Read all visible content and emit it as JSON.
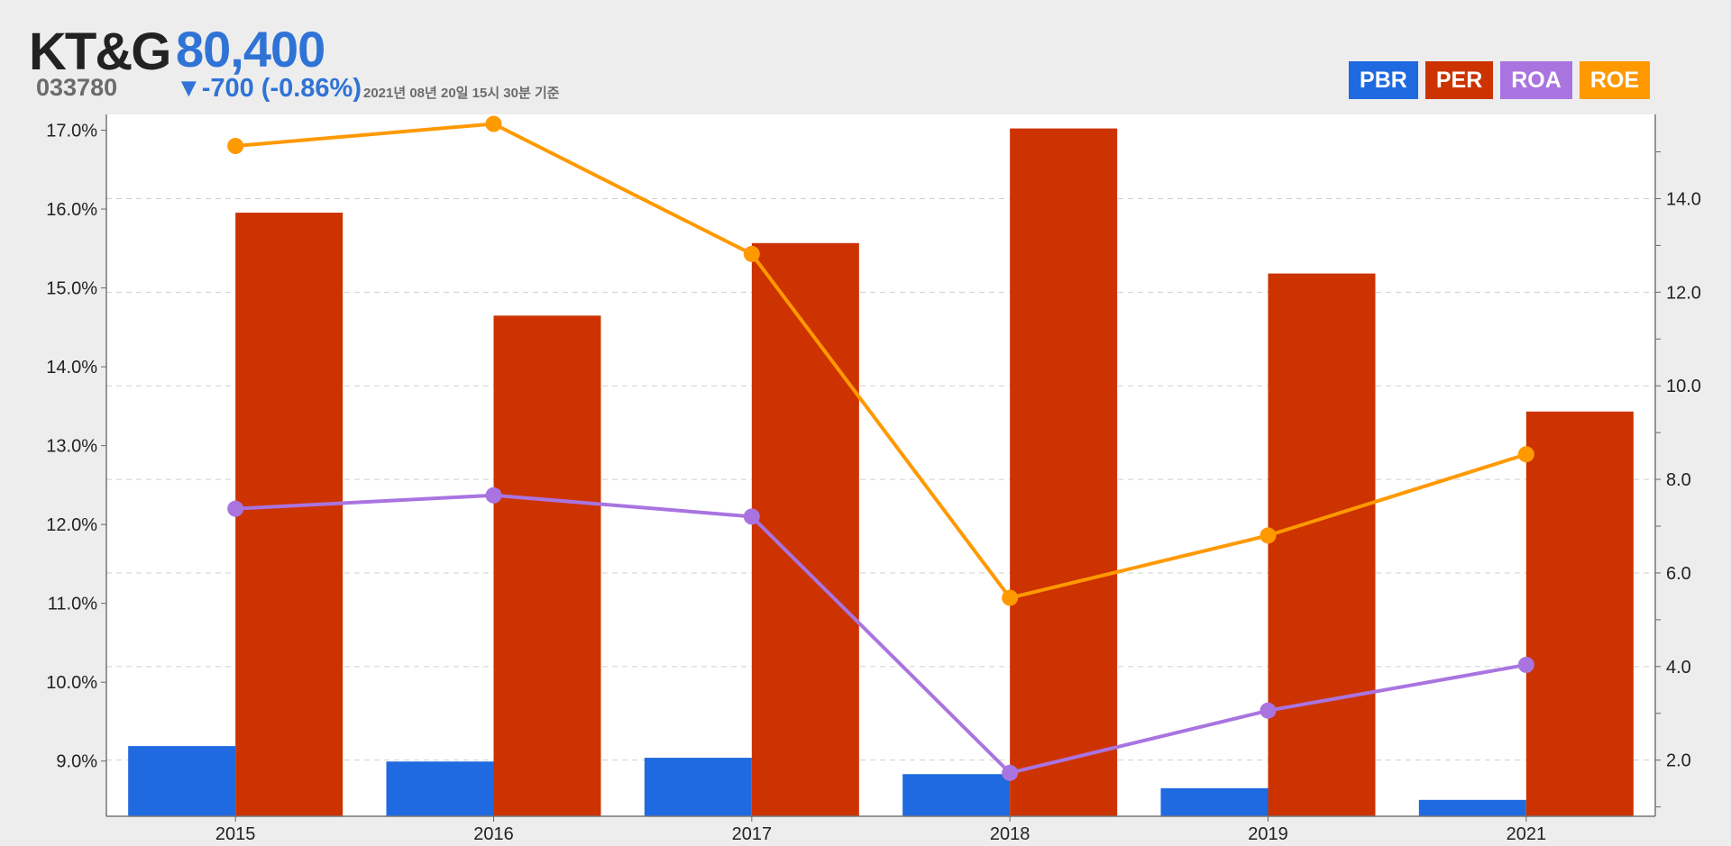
{
  "header": {
    "name": "KT&G",
    "price": "80,400",
    "code": "033780",
    "change": "▼-700 (-0.86%)",
    "as_of": "2021년 08년 20일 15시 30분 기준"
  },
  "legend": [
    {
      "label": "PBR",
      "color": "#1f6ae0"
    },
    {
      "label": "PER",
      "color": "#cc3300"
    },
    {
      "label": "ROA",
      "color": "#a974e0"
    },
    {
      "label": "ROE",
      "color": "#ff9900"
    }
  ],
  "chart_data": {
    "type": "bar",
    "categories": [
      "2015",
      "2016",
      "2017",
      "2018",
      "2019",
      "2021"
    ],
    "left_axis": {
      "ticks": [
        "9.0%",
        "10.0%",
        "11.0%",
        "12.0%",
        "13.0%",
        "14.0%",
        "15.0%",
        "16.0%",
        "17.0%"
      ],
      "range": [
        8.3,
        17.2
      ]
    },
    "right_axis": {
      "ticks": [
        "2.0",
        "4.0",
        "6.0",
        "8.0",
        "10.0",
        "12.0",
        "14.0"
      ],
      "range": [
        0.8,
        15.8
      ]
    },
    "grid": true,
    "series": [
      {
        "name": "PBR",
        "type": "bar",
        "axis": "right",
        "color": "#1f6ae0",
        "values": [
          2.3,
          1.97,
          2.05,
          1.7,
          1.4,
          1.15
        ]
      },
      {
        "name": "PER",
        "type": "bar",
        "axis": "right",
        "color": "#cc3300",
        "values": [
          13.7,
          11.5,
          13.05,
          15.5,
          12.4,
          9.45
        ]
      },
      {
        "name": "ROA",
        "type": "line",
        "axis": "left",
        "color": "#a974e0",
        "values": [
          12.2,
          12.37,
          12.1,
          8.85,
          9.64,
          10.22
        ]
      },
      {
        "name": "ROE",
        "type": "line",
        "axis": "left",
        "color": "#ff9900",
        "values": [
          16.8,
          17.08,
          15.43,
          11.07,
          11.86,
          12.89
        ]
      }
    ]
  }
}
